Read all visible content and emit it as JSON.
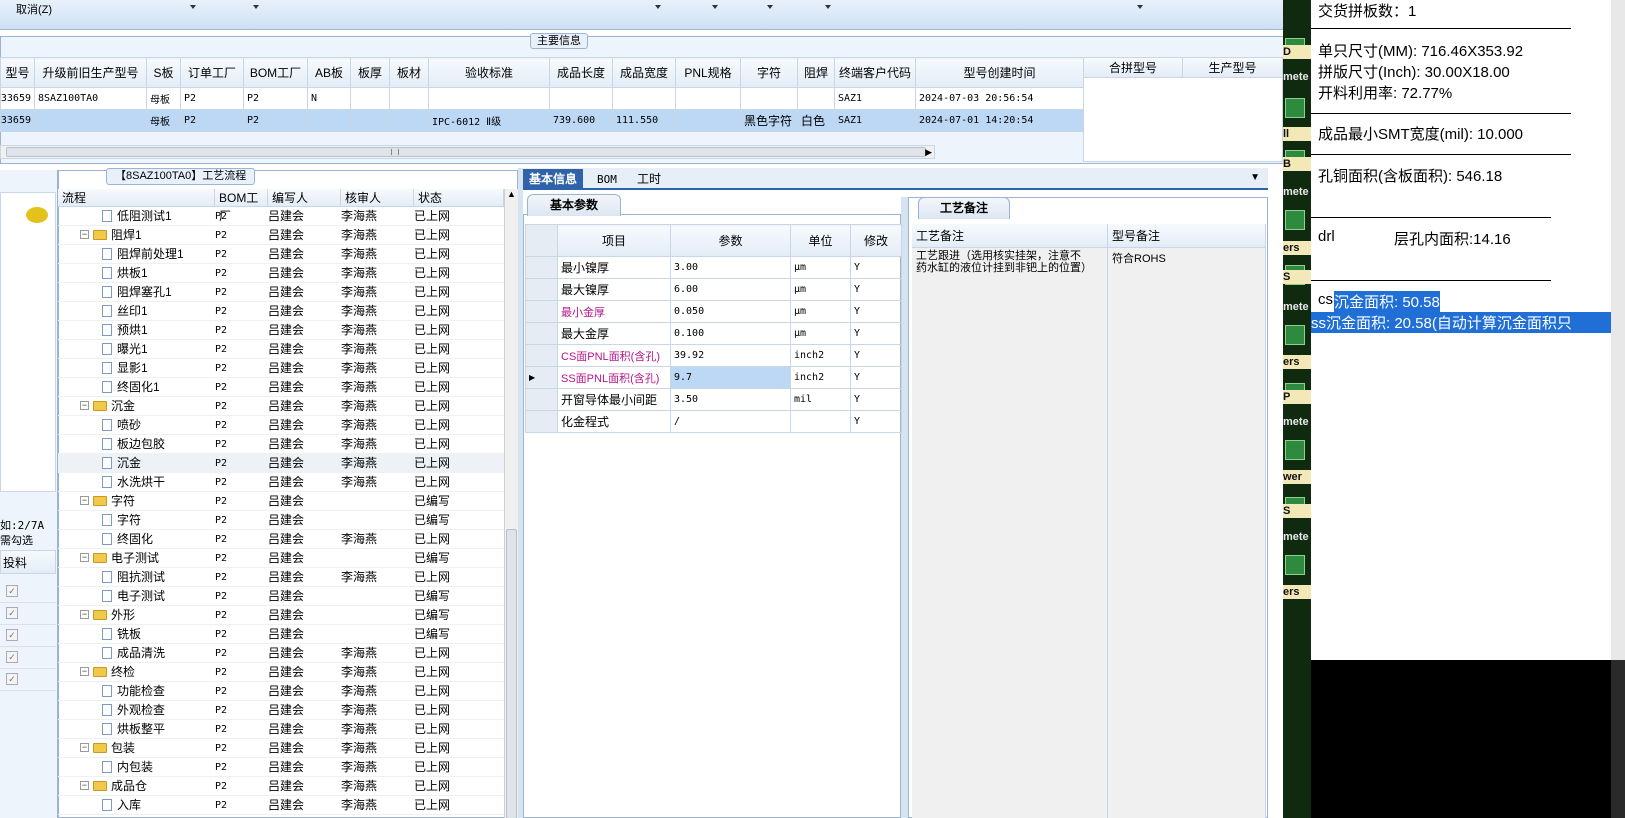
{
  "topbar": {
    "cancel_label": "取消(Z)"
  },
  "main_panel": {
    "title": "主要信息",
    "columns": [
      "型号",
      "升级前旧生产型号",
      "S板",
      "订单工厂",
      "BOM工厂",
      "AB板",
      "板厚",
      "板材",
      "验收标准",
      "成品长度",
      "成品宽度",
      "PNL规格",
      "字符",
      "阻焊",
      "终端客户代码",
      "型号创建时间"
    ],
    "rows": [
      {
        "model": "33659",
        "old": "8SAZ100TA0",
        "s": "母板",
        "order": "P2",
        "bom": "P2",
        "ab": "N",
        "thick": "",
        "mat": "",
        "std": "",
        "len": "",
        "wid": "",
        "pnl": "",
        "char": "",
        "mask": "",
        "cust": "SAZ1",
        "created": "2024-07-03 20:56:54"
      },
      {
        "model": "33659",
        "old": "",
        "s": "母板",
        "order": "P2",
        "bom": "P2",
        "ab": "",
        "thick": "",
        "mat": "",
        "std": "IPC-6012 Ⅱ级",
        "len": "739.600",
        "wid": "111.550",
        "pnl": "",
        "char": "黑色字符",
        "mask": "白色",
        "cust": "SAZ1",
        "created": "2024-07-01 14:20:54"
      }
    ],
    "merge_columns": [
      "合拼型号",
      "生产型号"
    ]
  },
  "left_panel": {
    "text1": "如:2/7A",
    "text2": "需勾选",
    "col_label": "投料",
    "checks": 5
  },
  "process": {
    "title": "【8SAZ100TA0】工艺流程",
    "columns": [
      "流程",
      "BOM工厂",
      "编写人",
      "核审人",
      "状态"
    ],
    "rows": [
      {
        "level": 2,
        "type": "doc",
        "name": "低阻测试1",
        "bom": "P2",
        "editor": "吕建会",
        "reviewer": "李海燕",
        "status": "已上网"
      },
      {
        "level": 1,
        "type": "folder",
        "name": "阻焊1",
        "bom": "P2",
        "editor": "吕建会",
        "reviewer": "李海燕",
        "status": "已上网"
      },
      {
        "level": 2,
        "type": "doc",
        "name": "阻焊前处理1",
        "bom": "P2",
        "editor": "吕建会",
        "reviewer": "李海燕",
        "status": "已上网"
      },
      {
        "level": 2,
        "type": "doc",
        "name": "烘板1",
        "bom": "P2",
        "editor": "吕建会",
        "reviewer": "李海燕",
        "status": "已上网"
      },
      {
        "level": 2,
        "type": "doc",
        "name": "阻焊塞孔1",
        "bom": "P2",
        "editor": "吕建会",
        "reviewer": "李海燕",
        "status": "已上网"
      },
      {
        "level": 2,
        "type": "doc",
        "name": "丝印1",
        "bom": "P2",
        "editor": "吕建会",
        "reviewer": "李海燕",
        "status": "已上网"
      },
      {
        "level": 2,
        "type": "doc",
        "name": "预烘1",
        "bom": "P2",
        "editor": "吕建会",
        "reviewer": "李海燕",
        "status": "已上网"
      },
      {
        "level": 2,
        "type": "doc",
        "name": "曝光1",
        "bom": "P2",
        "editor": "吕建会",
        "reviewer": "李海燕",
        "status": "已上网"
      },
      {
        "level": 2,
        "type": "doc",
        "name": "显影1",
        "bom": "P2",
        "editor": "吕建会",
        "reviewer": "李海燕",
        "status": "已上网"
      },
      {
        "level": 2,
        "type": "doc",
        "name": "终固化1",
        "bom": "P2",
        "editor": "吕建会",
        "reviewer": "李海燕",
        "status": "已上网"
      },
      {
        "level": 1,
        "type": "folder",
        "name": "沉金",
        "bom": "P2",
        "editor": "吕建会",
        "reviewer": "李海燕",
        "status": "已上网"
      },
      {
        "level": 2,
        "type": "doc",
        "name": "喷砂",
        "bom": "P2",
        "editor": "吕建会",
        "reviewer": "李海燕",
        "status": "已上网"
      },
      {
        "level": 2,
        "type": "doc",
        "name": "板边包胶",
        "bom": "P2",
        "editor": "吕建会",
        "reviewer": "李海燕",
        "status": "已上网"
      },
      {
        "level": 2,
        "type": "doc",
        "name": "沉金",
        "bom": "P2",
        "editor": "吕建会",
        "reviewer": "李海燕",
        "status": "已上网"
      },
      {
        "level": 2,
        "type": "doc",
        "name": "水洗烘干",
        "bom": "P2",
        "editor": "吕建会",
        "reviewer": "李海燕",
        "status": "已上网"
      },
      {
        "level": 1,
        "type": "folder",
        "name": "字符",
        "bom": "P2",
        "editor": "吕建会",
        "reviewer": "",
        "status": "已编写"
      },
      {
        "level": 2,
        "type": "doc",
        "name": "字符",
        "bom": "P2",
        "editor": "吕建会",
        "reviewer": "",
        "status": "已编写"
      },
      {
        "level": 2,
        "type": "doc",
        "name": "终固化",
        "bom": "P2",
        "editor": "吕建会",
        "reviewer": "李海燕",
        "status": "已上网"
      },
      {
        "level": 1,
        "type": "folder",
        "name": "电子测试",
        "bom": "P2",
        "editor": "吕建会",
        "reviewer": "",
        "status": "已编写"
      },
      {
        "level": 2,
        "type": "doc",
        "name": "阻抗测试",
        "bom": "P2",
        "editor": "吕建会",
        "reviewer": "李海燕",
        "status": "已上网"
      },
      {
        "level": 2,
        "type": "doc",
        "name": "电子测试",
        "bom": "P2",
        "editor": "吕建会",
        "reviewer": "",
        "status": "已编写"
      },
      {
        "level": 1,
        "type": "folder",
        "name": "外形",
        "bom": "P2",
        "editor": "吕建会",
        "reviewer": "",
        "status": "已编写"
      },
      {
        "level": 2,
        "type": "doc",
        "name": "铣板",
        "bom": "P2",
        "editor": "吕建会",
        "reviewer": "",
        "status": "已编写"
      },
      {
        "level": 2,
        "type": "doc",
        "name": "成品清洗",
        "bom": "P2",
        "editor": "吕建会",
        "reviewer": "李海燕",
        "status": "已上网"
      },
      {
        "level": 1,
        "type": "folder",
        "name": "终检",
        "bom": "P2",
        "editor": "吕建会",
        "reviewer": "李海燕",
        "status": "已上网"
      },
      {
        "level": 2,
        "type": "doc",
        "name": "功能检查",
        "bom": "P2",
        "editor": "吕建会",
        "reviewer": "李海燕",
        "status": "已上网"
      },
      {
        "level": 2,
        "type": "doc",
        "name": "外观检查",
        "bom": "P2",
        "editor": "吕建会",
        "reviewer": "李海燕",
        "status": "已上网"
      },
      {
        "level": 2,
        "type": "doc",
        "name": "烘板整平",
        "bom": "P2",
        "editor": "吕建会",
        "reviewer": "李海燕",
        "status": "已上网"
      },
      {
        "level": 1,
        "type": "folder",
        "name": "包装",
        "bom": "P2",
        "editor": "吕建会",
        "reviewer": "李海燕",
        "status": "已上网"
      },
      {
        "level": 2,
        "type": "doc",
        "name": "内包装",
        "bom": "P2",
        "editor": "吕建会",
        "reviewer": "李海燕",
        "status": "已上网"
      },
      {
        "level": 1,
        "type": "folder",
        "name": "成品仓",
        "bom": "P2",
        "editor": "吕建会",
        "reviewer": "李海燕",
        "status": "已上网"
      },
      {
        "level": 2,
        "type": "doc",
        "name": "入库",
        "bom": "P2",
        "editor": "吕建会",
        "reviewer": "李海燕",
        "status": "已上网"
      }
    ]
  },
  "info_tabs": [
    "基本信息",
    "BOM",
    "工时"
  ],
  "basic_params": {
    "tab": "基本参数",
    "columns": [
      "项目",
      "参数",
      "单位",
      "修改"
    ],
    "rows": [
      {
        "item": "最小镍厚",
        "value": "3.00",
        "unit": "μm",
        "mod": "Y",
        "color": "#000000"
      },
      {
        "item": "最大镍厚",
        "value": "6.00",
        "unit": "μm",
        "mod": "Y",
        "color": "#000000"
      },
      {
        "item": "最小金厚",
        "value": "0.050",
        "unit": "μm",
        "mod": "Y",
        "color": "#b5178a"
      },
      {
        "item": "最大金厚",
        "value": "0.100",
        "unit": "μm",
        "mod": "Y",
        "color": "#000000"
      },
      {
        "item": "CS面PNL面积(含孔)",
        "value": "39.92",
        "unit": "inch2",
        "mod": "Y",
        "color": "#b5178a"
      },
      {
        "item": "SS面PNL面积(含孔)",
        "value": "9.7",
        "unit": "inch2",
        "mod": "Y",
        "color": "#b5178a"
      },
      {
        "item": "开窗导体最小间距",
        "value": "3.50",
        "unit": "mil",
        "mod": "Y",
        "color": "#000000"
      },
      {
        "item": "化金程式",
        "value": "/",
        "unit": "",
        "mod": "Y",
        "color": "#000000"
      }
    ]
  },
  "remarks": {
    "tab": "工艺备注",
    "columns": [
      "工艺备注",
      "型号备注"
    ],
    "process_note": "工艺跟进（选用核实挂架，注意不药水缸的液位计挂到非钯上的位置）",
    "model_note": "符合ROHS"
  },
  "right_strip": {
    "labels": [
      "D",
      "mete",
      "ll",
      "B",
      "mete",
      "ers",
      "S",
      "mete",
      "ers",
      "P",
      "mete",
      "wer",
      "S",
      "mete",
      "ers"
    ]
  },
  "notepad": {
    "line1": "交货拼板数：1",
    "line2": "单只尺寸(MM): 716.46X353.92",
    "line3": "拼版尺寸(Inch): 30.00X18.00",
    "line4": "开料利用率: 72.77%",
    "line5": "成品最小SMT宽度(mil): 10.000",
    "line6": "孔铜面积(含板面积): 546.18",
    "line7a": "drl",
    "line7b": "层孔内面积:14.16",
    "line8a": "cs",
    "line8b": "沉金面积: 50.58",
    "line9": "ss沉金面积: 20.58(自动计算沉金面积只"
  }
}
